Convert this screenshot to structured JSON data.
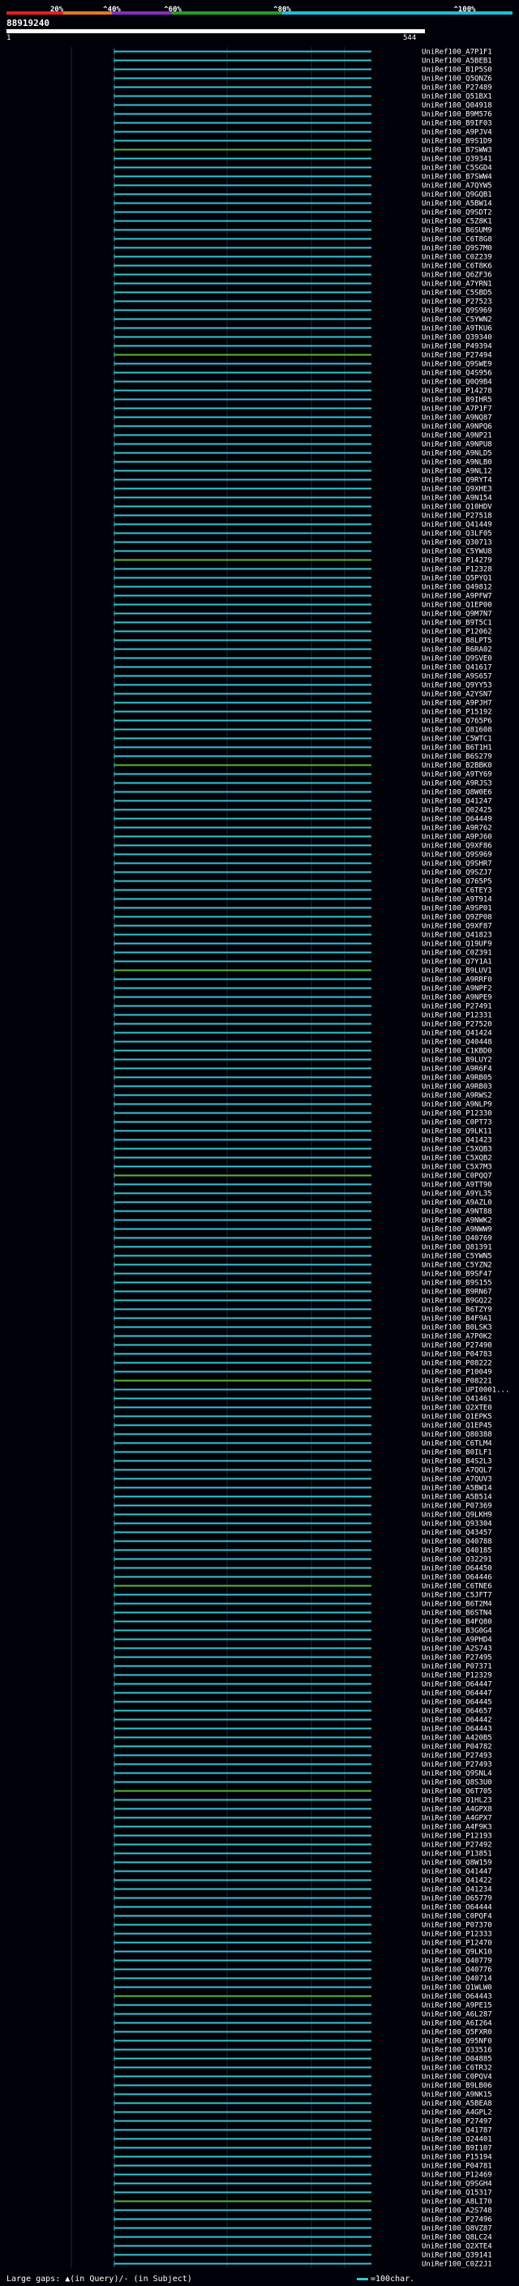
{
  "legend": {
    "labels": [
      "20%",
      "^40%",
      "^60%",
      "^80%",
      "^100%"
    ],
    "colors": [
      "#e8201a",
      "#e57b1c",
      "#8a2cc0",
      "#22a020",
      "#1fbcd8"
    ]
  },
  "query": {
    "label": "88919240",
    "scale_start": "1",
    "scale_end": "544"
  },
  "hit_color": "#35c4d4",
  "hit_color_alt": "#58b830",
  "hits": [
    "UniRef100_A7P1F1",
    "UniRef100_A5BEB1",
    "UniRef100_B1P5S0",
    "UniRef100_Q5QNZ6",
    "UniRef100_P27489",
    "UniRef100_Q51BX1",
    "UniRef100_Q04918",
    "UniRef100_B9M576",
    "UniRef100_B9IF03",
    "UniRef100_A9PJV4",
    "UniRef100_B9S1D9",
    "UniRef100_B7SWW3",
    "UniRef100_Q39341",
    "UniRef100_C5SGD4",
    "UniRef100_B7SWW4",
    "UniRef100_A7QYW5",
    "UniRef100_Q9GQB1",
    "UniRef100_A5BW14",
    "UniRef100_Q9SDT2",
    "UniRef100_C5Z8K1",
    "UniRef100_B6SUM9",
    "UniRef100_C6T8G8",
    "UniRef100_Q9S7M0",
    "UniRef100_C0Z239",
    "UniRef100_C6T8K6",
    "UniRef100_Q6ZF36",
    "UniRef100_A7YRN1",
    "UniRef100_C5SBD5",
    "UniRef100_P27523",
    "UniRef100_Q9S969",
    "UniRef100_C5YWN2",
    "UniRef100_A9TKU6",
    "UniRef100_Q39340",
    "UniRef100_P49394",
    "UniRef100_P27494",
    "UniRef100_Q9SWE9",
    "UniRef100_Q4S956",
    "UniRef100_Q0Q9B4",
    "UniRef100_P14278",
    "UniRef100_B9IHR5",
    "UniRef100_A7P1F7",
    "UniRef100_A9NQ87",
    "UniRef100_A9NPQ6",
    "UniRef100_A9NP21",
    "UniRef100_A9NPU8",
    "UniRef100_A9NLD5",
    "UniRef100_A9NLB0",
    "UniRef100_A9NL12",
    "UniRef100_Q9RYT4",
    "UniRef100_Q9XHE3",
    "UniRef100_A9N154",
    "UniRef100_Q10HDV",
    "UniRef100_P27518",
    "UniRef100_Q41449",
    "UniRef100_Q3LF05",
    "UniRef100_Q30713",
    "UniRef100_C5YWU8",
    "UniRef100_P14279",
    "UniRef100_P12328",
    "UniRef100_Q5PYQ1",
    "UniRef100_Q49812",
    "UniRef100_A9PFW7",
    "UniRef100_Q1EP00",
    "UniRef100_Q9M7N7",
    "UniRef100_B9T5C1",
    "UniRef100_P12062",
    "UniRef100_B8LPT5",
    "UniRef100_B6RA02",
    "UniRef100_Q9SVE0",
    "UniRef100_Q41617",
    "UniRef100_A9S657",
    "UniRef100_Q9YY53",
    "UniRef100_A2YSN7",
    "UniRef100_A9PJH7",
    "UniRef100_P15192",
    "UniRef100_Q765P6",
    "UniRef100_Q81608",
    "UniRef100_C5WTC1",
    "UniRef100_B6T1H1",
    "UniRef100_B6S279",
    "UniRef100_B2BBK0",
    "UniRef100_A9TY69",
    "UniRef100_A9RJS3",
    "UniRef100_Q8W0E6",
    "UniRef100_Q41247",
    "UniRef100_Q02425",
    "UniRef100_Q64449",
    "UniRef100_A9R762",
    "UniRef100_A9PJ60",
    "UniRef100_Q9XF86",
    "UniRef100_Q9S969",
    "UniRef100_Q9SHR7",
    "UniRef100_Q9SZJ7",
    "UniRef100_Q765P5",
    "UniRef100_C6TEY3",
    "UniRef100_A9T914",
    "UniRef100_A9SP01",
    "UniRef100_Q9ZP08",
    "UniRef100_Q9XF87",
    "UniRef100_Q41823",
    "UniRef100_Q19UF9",
    "UniRef100_C0Z391",
    "UniRef100_Q7Y1A1",
    "UniRef100_B9LUV1",
    "UniRef100_A9RRF0",
    "UniRef100_A9NPF2",
    "UniRef100_A9NPE9",
    "UniRef100_P27491",
    "UniRef100_P12331",
    "UniRef100_P27520",
    "UniRef100_Q41424",
    "UniRef100_Q40448",
    "UniRef100_C1KBD0",
    "UniRef100_B9LUY2",
    "UniRef100_A9R6F4",
    "UniRef100_A9RB05",
    "UniRef100_A9RB03",
    "UniRef100_A9RWS2",
    "UniRef100_A9NLP9",
    "UniRef100_P12330",
    "UniRef100_C0PT73",
    "UniRef100_Q9LK11",
    "UniRef100_Q41423",
    "UniRef100_C5XQB3",
    "UniRef100_C5XQB2",
    "UniRef100_C5X7M3",
    "UniRef100_C0PQQ7",
    "UniRef100_A9TT90",
    "UniRef100_A9YL35",
    "UniRef100_A9AZL0",
    "UniRef100_A9NT88",
    "UniRef100_A9NWK2",
    "UniRef100_A9NWW9",
    "UniRef100_Q40769",
    "UniRef100_Q81391",
    "UniRef100_C5YWN5",
    "UniRef100_C5YZN2",
    "UniRef100_B9SF47",
    "UniRef100_B9S155",
    "UniRef100_B9RN67",
    "UniRef100_B9GQ22",
    "UniRef100_B6TZY9",
    "UniRef100_B4F9A1",
    "UniRef100_B0LSK3",
    "UniRef100_A7P0K2",
    "UniRef100_P27490",
    "UniRef100_P04783",
    "UniRef100_P08222",
    "UniRef100_P10049",
    "UniRef100_P08221",
    "UniRef100_UPI0001...",
    "UniRef100_Q41461",
    "UniRef100_Q2XTE0",
    "UniRef100_Q1EPK5",
    "UniRef100_Q1EP45",
    "UniRef100_Q80388",
    "UniRef100_C6TLM4",
    "UniRef100_B0ILF1",
    "UniRef100_B4S2L3",
    "UniRef100_A7QQL7",
    "UniRef100_A7QUV3",
    "UniRef100_A5BW14",
    "UniRef100_A5B514",
    "UniRef100_P07369",
    "UniRef100_Q9LKH9",
    "UniRef100_Q93304",
    "UniRef100_Q43457",
    "UniRef100_Q40788",
    "UniRef100_Q40185",
    "UniRef100_Q32291",
    "UniRef100_O64450",
    "UniRef100_O64446",
    "UniRef100_C6TNE6",
    "UniRef100_C5JFT7",
    "UniRef100_B6T2M4",
    "UniRef100_B6STN4",
    "UniRef100_B4FQ80",
    "UniRef100_B3G0G4",
    "UniRef100_A9PHD4",
    "UniRef100_A2S743",
    "UniRef100_P27495",
    "UniRef100_P07371",
    "UniRef100_P12329",
    "UniRef100_O64447",
    "UniRef100_O64447",
    "UniRef100_O64445",
    "UniRef100_O64657",
    "UniRef100_O64442",
    "UniRef100_O64443",
    "UniRef100_A420B5",
    "UniRef100_P04782",
    "UniRef100_P27493",
    "UniRef100_P27493",
    "UniRef100_Q9SNL4",
    "UniRef100_Q8S3U0",
    "UniRef100_Q6T705",
    "UniRef100_Q1HL23",
    "UniRef100_A4GPX8",
    "UniRef100_A4GPX7",
    "UniRef100_A4F9K3",
    "UniRef100_P12193",
    "UniRef100_P27492",
    "UniRef100_P13851",
    "UniRef100_Q8W159",
    "UniRef100_Q41447",
    "UniRef100_Q41422",
    "UniRef100_Q41234",
    "UniRef100_O65779",
    "UniRef100_O64444",
    "UniRef100_C0PQF4",
    "UniRef100_P07370",
    "UniRef100_P12333",
    "UniRef100_P12470",
    "UniRef100_Q9LK10",
    "UniRef100_Q40779",
    "UniRef100_Q40776",
    "UniRef100_Q40714",
    "UniRef100_Q1WLW0",
    "UniRef100_O64443",
    "UniRef100_A9PE15",
    "UniRef100_A6L287",
    "UniRef100_A6I264",
    "UniRef100_Q5FXR0",
    "UniRef100_Q95NF0",
    "UniRef100_Q33516",
    "UniRef100_O04885",
    "UniRef100_C6TR32",
    "UniRef100_C0PQV4",
    "UniRef100_B9LB06",
    "UniRef100_A9NK15",
    "UniRef100_A5BEA8",
    "UniRef100_A4GPL2",
    "UniRef100_P27497",
    "UniRef100_Q41787",
    "UniRef100_Q24401",
    "UniRef100_B9I107",
    "UniRef100_P15194",
    "UniRef100_P04781",
    "UniRef100_P12469",
    "UniRef100_Q9SGH4",
    "UniRef100_Q15317",
    "UniRef100_A8LI70",
    "UniRef100_A2S748",
    "UniRef100_P27496",
    "UniRef100_Q8VZ87",
    "UniRef100_Q8LC24",
    "UniRef100_Q2XTE4",
    "UniRef100_Q39141",
    "UniRef100_C0Z2J1"
  ],
  "footer": {
    "large_gaps": "Large gaps: ▲(in Query)/- (in Subject)",
    "scale_note": "=100char."
  }
}
